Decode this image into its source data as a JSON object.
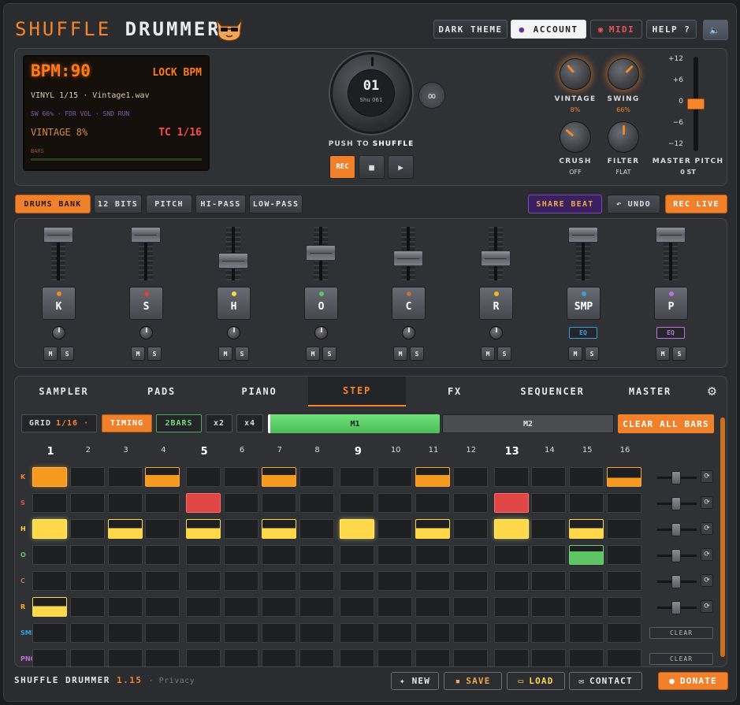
{
  "header": {
    "logo_a": "SHUFFLE",
    "logo_b": "DRUMMER",
    "buttons": {
      "dark_theme": "DARK THEME",
      "account": "ACCOUNT",
      "midi": "MIDI",
      "help": "HELP ?"
    }
  },
  "display": {
    "bpm": "BPM:90",
    "lock": "LOCK BPM",
    "file": "VINYL 1/15 · Vintage1.wav",
    "info": "SW 66% · FDR VOL · SND RUN",
    "vintage": "VINTAGE 8%",
    "tc": "TC 1/16",
    "bars": "BARS"
  },
  "dial": {
    "number": "01",
    "sub": "Shu 061",
    "push_a": "PUSH TO",
    "push_b": "SHUFFLE"
  },
  "transport": {
    "rec": "REC",
    "stop": "■",
    "play": "▶",
    "loop": "∞"
  },
  "knobs": [
    {
      "label": "VINTAGE",
      "value": "8%"
    },
    {
      "label": "SWING",
      "value": "66%"
    },
    {
      "label": "CRUSH",
      "value": "OFF"
    },
    {
      "label": "FILTER",
      "value": "FLAT"
    }
  ],
  "pitch": {
    "scale": [
      "+12",
      "+6",
      "0",
      "−6",
      "−12"
    ],
    "label": "MASTER PITCH",
    "value": "0 ST"
  },
  "toolbar": {
    "drums_bank": "DRUMS BANK",
    "bits": "12 BITS",
    "pitch": "PITCH",
    "hipass": "HI-PASS",
    "lowpass": "LOW-PASS",
    "share": "SHARE BEAT",
    "undo": "↶ UNDO",
    "rec_live": "REC LIVE"
  },
  "mixer": {
    "channels": [
      {
        "name": "K",
        "dot": "#f5852a",
        "level": 1.0,
        "eq": false
      },
      {
        "name": "S",
        "dot": "#e04040",
        "level": 1.0,
        "eq": false
      },
      {
        "name": "H",
        "dot": "#ffd84a",
        "level": 0.35,
        "eq": false
      },
      {
        "name": "O",
        "dot": "#5ec566",
        "level": 0.55,
        "eq": false
      },
      {
        "name": "C",
        "dot": "#c0703a",
        "level": 0.4,
        "eq": false
      },
      {
        "name": "R",
        "dot": "#ffb020",
        "level": 0.4,
        "eq": false
      },
      {
        "name": "SMP",
        "dot": "#3a9ee0",
        "level": 1.0,
        "eq": true,
        "eq_color": "#3a9ee0"
      },
      {
        "name": "P",
        "dot": "#c070e0",
        "level": 1.0,
        "eq": true,
        "eq_color": "#c070e0"
      }
    ],
    "mute": "M",
    "solo": "S",
    "eq": "EQ"
  },
  "tabs": [
    "SAMPLER",
    "PADS",
    "PIANO",
    "STEP",
    "FX",
    "SEQUENCER",
    "MASTER"
  ],
  "active_tab": "STEP",
  "step": {
    "grid_label": "GRID",
    "grid_value": "1/16 ·",
    "timing": "TIMING",
    "bars2": "2BARS",
    "x2": "x2",
    "x4": "x4",
    "m1": "M1",
    "m2": "M2",
    "clear_all": "CLEAR ALL BARS",
    "numbers": [
      "1",
      "2",
      "3",
      "4",
      "5",
      "6",
      "7",
      "8",
      "9",
      "10",
      "11",
      "12",
      "13",
      "14",
      "15",
      "16"
    ],
    "rows": [
      {
        "label": "K",
        "color": "#f5852a",
        "cells": [
          "fo",
          "",
          "",
          "ho",
          "",
          "",
          "ho",
          "",
          "",
          "",
          "ho",
          "",
          "",
          "",
          "",
          "ho2"
        ]
      },
      {
        "label": "S",
        "color": "#e05050",
        "cells": [
          "",
          "",
          "",
          "",
          "fr",
          "",
          "",
          "",
          "",
          "",
          "",
          "",
          "fr",
          "",
          "",
          ""
        ]
      },
      {
        "label": "H",
        "color": "#ffd84a",
        "cells": [
          "fy",
          "",
          "hy",
          "",
          "hy",
          "",
          "hy",
          "",
          "fy",
          "",
          "hy",
          "",
          "fy",
          "",
          "hy",
          ""
        ]
      },
      {
        "label": "O",
        "color": "#5ec566",
        "cells": [
          "",
          "",
          "",
          "",
          "",
          "",
          "",
          "",
          "",
          "",
          "",
          "",
          "",
          "",
          "hg",
          ""
        ]
      },
      {
        "label": "C",
        "color": "#b07a50",
        "cells": [
          "",
          "",
          "",
          "",
          "",
          "",
          "",
          "",
          "",
          "",
          "",
          "",
          "",
          "",
          "",
          ""
        ]
      },
      {
        "label": "R",
        "color": "#ffb020",
        "cells": [
          "hy",
          "",
          "",
          "",
          "",
          "",
          "",
          "",
          "",
          "",
          "",
          "",
          "",
          "",
          "",
          ""
        ]
      },
      {
        "label": "SMP",
        "color": "#3a9ee0",
        "cells": [
          "",
          "",
          "",
          "",
          "",
          "",
          "",
          "",
          "",
          "",
          "",
          "",
          "",
          "",
          "",
          ""
        ]
      },
      {
        "label": "PNO",
        "color": "#c070e0",
        "cells": [
          "",
          "",
          "",
          "",
          "",
          "",
          "",
          "",
          "",
          "",
          "",
          "",
          "",
          "",
          "",
          ""
        ]
      }
    ],
    "clear": "CLEAR"
  },
  "footer": {
    "name": "SHUFFLE DRUMMER",
    "version": "1.15",
    "privacy": "· Privacy",
    "new": "✦ NEW",
    "save": "SAVE",
    "load": "LOAD",
    "contact": "CONTACT",
    "donate": "DONATE"
  }
}
